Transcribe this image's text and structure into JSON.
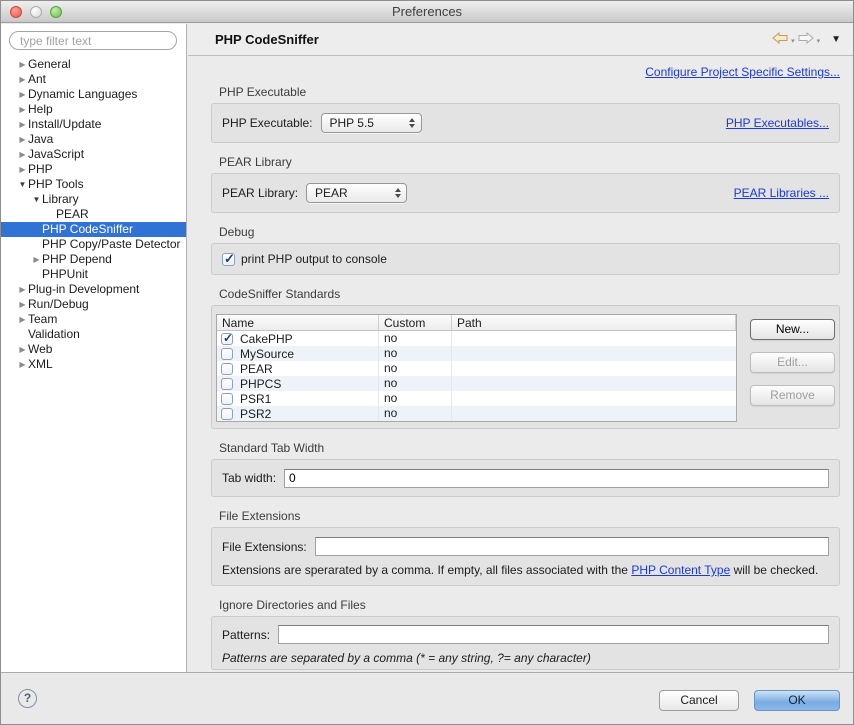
{
  "window": {
    "title": "Preferences"
  },
  "icons": {
    "back": "left-arrow",
    "forward": "right-arrow",
    "dropdown_caret": "▾",
    "view_menu_caret": "▼",
    "help": "?"
  },
  "colors": {
    "selection_blue": "#3173d5",
    "link_blue": "#1c3bd4",
    "ok_button_blue": "#78abe2",
    "panel_gray": "#e3e3e3"
  },
  "sidebar": {
    "filter_placeholder": "type filter text",
    "items": [
      {
        "label": "General",
        "state": "collapsed",
        "level": 0
      },
      {
        "label": "Ant",
        "state": "collapsed",
        "level": 0
      },
      {
        "label": "Dynamic Languages",
        "state": "collapsed",
        "level": 0
      },
      {
        "label": "Help",
        "state": "collapsed",
        "level": 0
      },
      {
        "label": "Install/Update",
        "state": "collapsed",
        "level": 0
      },
      {
        "label": "Java",
        "state": "collapsed",
        "level": 0
      },
      {
        "label": "JavaScript",
        "state": "collapsed",
        "level": 0
      },
      {
        "label": "PHP",
        "state": "collapsed",
        "level": 0
      },
      {
        "label": "PHP Tools",
        "state": "expanded",
        "level": 0
      },
      {
        "label": "Library",
        "state": "expanded",
        "level": 1
      },
      {
        "label": "PEAR",
        "state": "none",
        "level": 2
      },
      {
        "label": "PHP CodeSniffer",
        "state": "none",
        "level": 1,
        "selected": true
      },
      {
        "label": "PHP Copy/Paste Detector",
        "state": "none",
        "level": 1
      },
      {
        "label": "PHP Depend",
        "state": "collapsed",
        "level": 1
      },
      {
        "label": "PHPUnit",
        "state": "none",
        "level": 1
      },
      {
        "label": "Plug-in Development",
        "state": "collapsed",
        "level": 0
      },
      {
        "label": "Run/Debug",
        "state": "collapsed",
        "level": 0
      },
      {
        "label": "Team",
        "state": "collapsed",
        "level": 0
      },
      {
        "label": "Validation",
        "state": "none",
        "level": 0
      },
      {
        "label": "Web",
        "state": "collapsed",
        "level": 0
      },
      {
        "label": "XML",
        "state": "collapsed",
        "level": 0
      }
    ]
  },
  "header": {
    "title": "PHP CodeSniffer",
    "configure_link": "Configure Project Specific Settings..."
  },
  "sections": {
    "php_executable": {
      "group": "PHP Executable",
      "field_label": "PHP Executable:",
      "dropdown_value": "PHP 5.5",
      "link": "PHP Executables..."
    },
    "pear_library": {
      "group": "PEAR Library",
      "field_label": "PEAR Library:",
      "dropdown_value": "PEAR",
      "link": "PEAR Libraries ..."
    },
    "debug": {
      "group": "Debug",
      "checkbox_label": "print PHP output to console",
      "checked": true
    },
    "standards": {
      "group": "CodeSniffer Standards",
      "columns": [
        "Name",
        "Custom",
        "Path"
      ],
      "rows": [
        {
          "name": "CakePHP",
          "custom": "no",
          "path": "",
          "checked": true
        },
        {
          "name": "MySource",
          "custom": "no",
          "path": "",
          "checked": false
        },
        {
          "name": "PEAR",
          "custom": "no",
          "path": "",
          "checked": false
        },
        {
          "name": "PHPCS",
          "custom": "no",
          "path": "",
          "checked": false
        },
        {
          "name": "PSR1",
          "custom": "no",
          "path": "",
          "checked": false
        },
        {
          "name": "PSR2",
          "custom": "no",
          "path": "",
          "checked": false
        }
      ],
      "buttons": {
        "new": "New...",
        "edit": "Edit...",
        "remove": "Remove"
      }
    },
    "tab_width": {
      "group": "Standard Tab Width",
      "field_label": "Tab width:",
      "value": "0"
    },
    "file_extensions": {
      "group": "File Extensions",
      "field_label": "File Extensions:",
      "value": "",
      "help_prefix": "Extensions are sperarated by a comma. If empty, all files associated with the ",
      "help_link": "PHP Content Type",
      "help_suffix": " will be checked."
    },
    "ignore": {
      "group": "Ignore Directories and Files",
      "field_label": "Patterns:",
      "value": "",
      "help": "Patterns are separated by a comma (* = any string, ?= any character)"
    }
  },
  "footer": {
    "help": "?",
    "cancel": "Cancel",
    "ok": "OK"
  }
}
